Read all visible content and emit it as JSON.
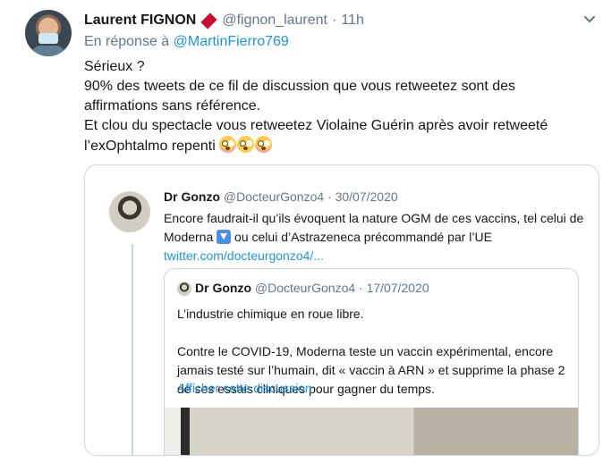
{
  "tweet": {
    "display_name": "Laurent FIGNON",
    "handle": "@fignon_laurent",
    "separator": "·",
    "time": "11h",
    "reply_prefix": "En réponse à",
    "reply_mention": "@MartinFierro769",
    "lines": [
      "Sérieux ?",
      "90% des tweets de ce fil de discussion que vous retweetez sont des affirmations sans référence.",
      "Et clou du spectacle vous retweetez Violaine Guérin après avoir retweeté l’exOphtalmo repenti"
    ],
    "emojis": [
      "flushed-face",
      "face-with-rolling-eyes",
      "flushed-face"
    ]
  },
  "quoted": {
    "display_name": "Dr Gonzo",
    "handle_time": "@DocteurGonzo4 · 30/07/2020",
    "text_before_icon": "Encore faudrait-il qu’ils évoquent la nature OGM de ces vaccins, tel celui de Moderna",
    "text_after_icon": " ou celui d’Astrazeneca précommandé par l’UE",
    "link": "twitter.com/docteurgonzo4/..."
  },
  "nested": {
    "display_name": "Dr Gonzo",
    "handle_time": "@DocteurGonzo4 · 17/07/2020",
    "paragraph1": "L’industrie chimique en roue libre.",
    "paragraph2": "Contre le COVID-19, Moderna teste un vaccin expérimental, encore jamais testé sur l’humain, dit « vaccin à ARN » et supprime la phase 2 de ses essais cliniques pour gagner du temps.",
    "show_thread": "Afficher cette discussion"
  },
  "colors": {
    "link": "#1b95e0",
    "muted": "#657786",
    "text": "#14171a",
    "border": "#ccd6dd",
    "diamond": "#c8102e"
  },
  "icons": [
    "chevron-down-icon",
    "diamond-icon",
    "arrow-down-icon"
  ]
}
